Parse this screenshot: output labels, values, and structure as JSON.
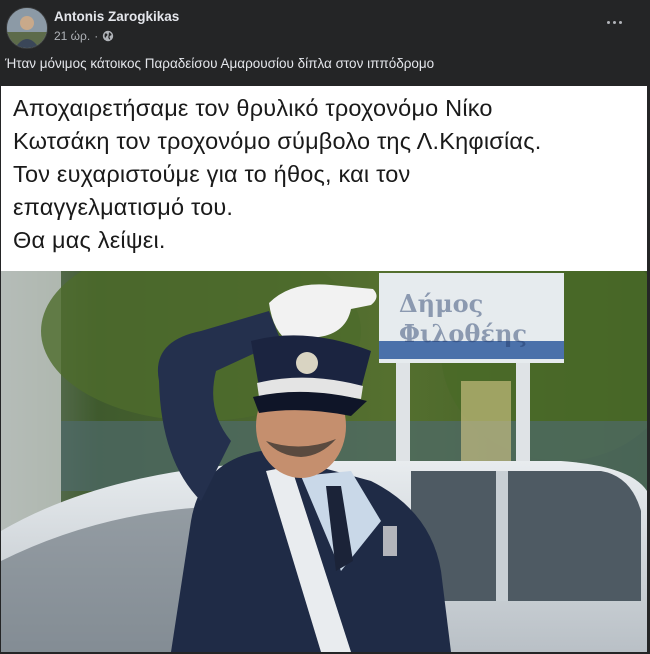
{
  "post": {
    "author": "Antonis Zarogkikas",
    "timestamp": "21 ώρ.",
    "separator": "·",
    "privacy_icon": "globe-icon",
    "more_icon": "more-options-icon",
    "caption": "Ήταν μόνιμος κάτοικος Παραδείσου Αμαρουσίου δίπλα στον ιππόδρομο"
  },
  "image_text": {
    "lines": [
      "Αποχαιρετήσαμε τον θρυλικό τροχονόμο Νίκο",
      "Κωτσάκη τον τροχονόμο σύμβολο της Λ.Κηφισίας.",
      "Τον ευχαριστούμε για το ήθος, και τον",
      "επαγγελματισμό του.",
      "Θα μας λείψει."
    ]
  },
  "photo": {
    "sign_lines": [
      "Δήμος",
      "Φιλοθέης"
    ]
  },
  "colors": {
    "background": "#242526",
    "text_primary": "#e4e6eb",
    "text_secondary": "#b0b3b8",
    "uniform": "#1e2a44"
  }
}
